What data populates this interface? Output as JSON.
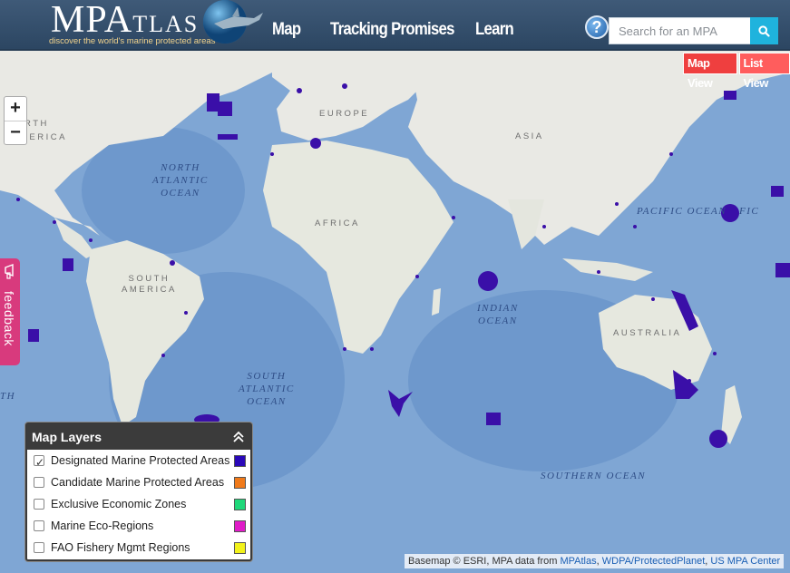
{
  "header": {
    "logo_main": "MPA",
    "logo_small": "TLAS",
    "logo_tagline": "discover the world's marine protected areas",
    "nav": [
      "Map",
      "Tracking Promises",
      "Learn"
    ],
    "help_glyph": "?",
    "search_placeholder": "Search for an MPA"
  },
  "view_toggle": {
    "map": "Map View",
    "list": "List View"
  },
  "zoom": {
    "in": "+",
    "out": "−"
  },
  "feedback": {
    "label": "feedback"
  },
  "map_labels": {
    "north_atlantic": [
      "NORTH",
      "ATLANTIC",
      "OCEAN"
    ],
    "south_atlantic": [
      "SOUTH",
      "ATLANTIC",
      "OCEAN"
    ],
    "indian": [
      "INDIAN",
      "OCEAN"
    ],
    "pacific": "PACIFIC OCEAN",
    "southern": "SOUTHERN OCEAN",
    "europe": "EUROPE",
    "asia": "ASIA",
    "africa": "AFRICA",
    "south_america": [
      "SOUTH",
      "AMERICA"
    ],
    "australia": "AUSTRALIA",
    "edge_north": "RTH",
    "edge_america": "MERICA",
    "edge_th": "TH",
    "edge_fic": "FIC"
  },
  "layers": {
    "title": "Map Layers",
    "items": [
      {
        "label": "Designated Marine Protected Areas",
        "checked": true,
        "color": "#2a08b8"
      },
      {
        "label": "Candidate Marine Protected Areas",
        "checked": false,
        "color": "#f07a1a"
      },
      {
        "label": "Exclusive Economic Zones",
        "checked": false,
        "color": "#1fd87a"
      },
      {
        "label": "Marine Eco-Regions",
        "checked": false,
        "color": "#e01cc8"
      },
      {
        "label": "FAO Fishery Mgmt Regions",
        "checked": false,
        "color": "#f2f21a"
      }
    ]
  },
  "attribution": {
    "prefix": "Basemap © ESRI, MPA data from",
    "link1": "MPAtlas",
    "link2": "WDPA/ProtectedPlanet",
    "link3": "US MPA Center",
    "sep": ","
  },
  "colors": {
    "accent": "#1fb3dd",
    "mpa": "#3a0fa8",
    "ocean": "#7fa6d4",
    "land": "#e9e9e4"
  }
}
